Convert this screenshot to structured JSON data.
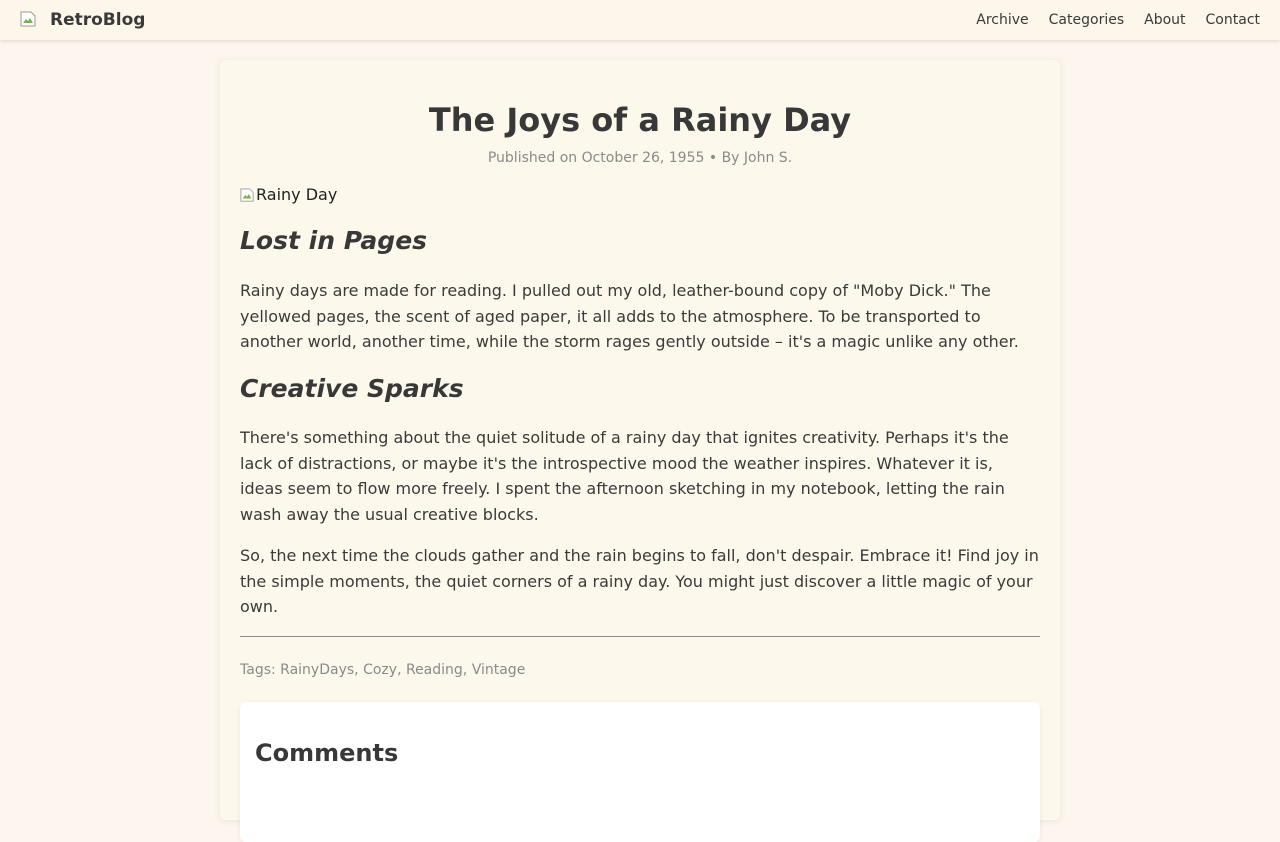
{
  "header": {
    "brand": "RetroBlog",
    "nav": [
      "Archive",
      "Categories",
      "About",
      "Contact"
    ]
  },
  "article": {
    "title": "The Joys of a Rainy Day",
    "meta": {
      "calendar_glyph": "",
      "published": "Published on October 26, 1955",
      "separator": "•",
      "author_glyph": "",
      "author": "By John S."
    },
    "hero_alt": "Rainy Day",
    "sections": [
      {
        "heading": "Lost in Pages",
        "paragraphs": [
          "Rainy days are made for reading. I pulled out my old, leather-bound copy of \"Moby Dick.\" The yellowed pages, the scent of aged paper, it all adds to the atmosphere. To be transported to another world, another time, while the storm rages gently outside – it's a magic unlike any other."
        ]
      },
      {
        "heading": "Creative Sparks",
        "paragraphs": [
          "There's something about the quiet solitude of a rainy day that ignites creativity. Perhaps it's the lack of distractions, or maybe it's the introspective mood the weather inspires. Whatever it is, ideas seem to flow more freely. I spent the afternoon sketching in my notebook, letting the rain wash away the usual creative blocks.",
          "So, the next time the clouds gather and the rain begins to fall, don't despair. Embrace it! Find joy in the simple moments, the quiet corners of a rainy day. You might just discover a little magic of your own."
        ]
      }
    ],
    "tags": {
      "glyph": "",
      "label": "Tags:",
      "items": [
        "RainyDays",
        "Cozy",
        "Reading",
        "Vintage"
      ]
    }
  },
  "comments": {
    "heading": "Comments"
  },
  "colors": {
    "background": "#fdf6ee",
    "card": "#fdf8ec",
    "text": "#3a3a3a",
    "muted": "#8a8a8a"
  },
  "icons": [
    "broken-image-icon",
    "calendar-icon",
    "user-icon",
    "tag-icon"
  ]
}
